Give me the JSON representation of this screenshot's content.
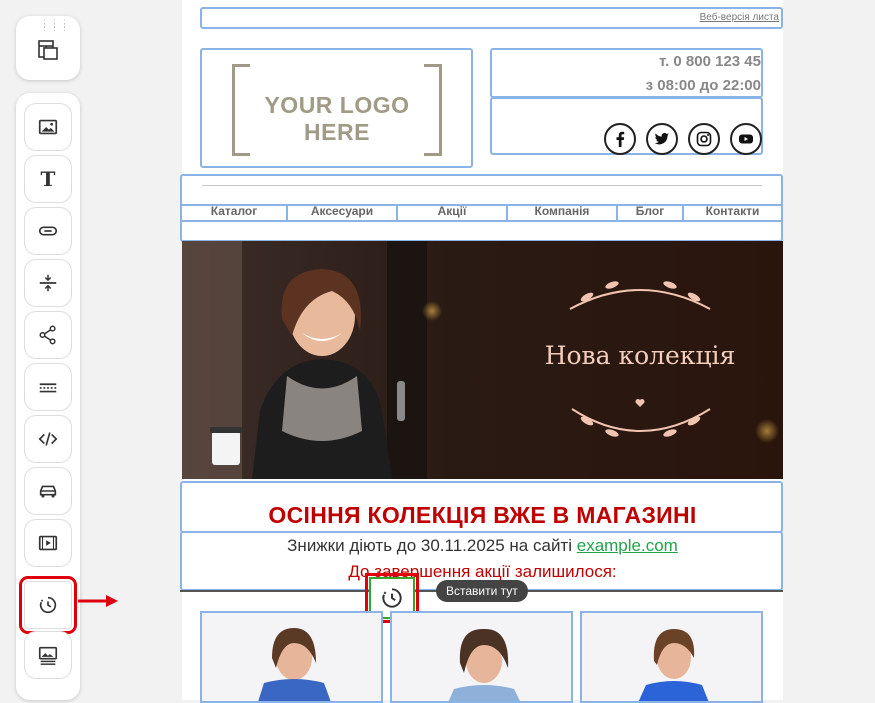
{
  "email": {
    "web_version_link": "Веб-версія листа",
    "logo_text": "YOUR LOGO HERE",
    "phone": "т. 0 800 123 45",
    "hours": "з 08:00 до 22:00",
    "social_icons": [
      "facebook-icon",
      "twitter-icon",
      "instagram-icon",
      "youtube-icon"
    ],
    "nav": [
      "Каталог",
      "Аксесуари",
      "Акції",
      "Компанія",
      "Блог",
      "Контакти"
    ],
    "banner_title": "Нова колекція",
    "headline": "ОСІННЯ КОЛЕКЦІЯ ВЖЕ В МАГАЗИНІ",
    "discount_text": "Знижки діють до 30.11.2025 на сайті",
    "site_link": "example.com",
    "countdown_label": "До завершення акції залишилося:"
  },
  "drop_tooltip": "Вставити тут",
  "toolbar": {
    "items": [
      "image-tool-icon",
      "text-tool-icon",
      "button-tool-icon",
      "spacer-tool-icon",
      "social-share-tool-icon",
      "divider-tool-icon",
      "html-code-tool-icon",
      "car-tool-icon",
      "video-tool-icon",
      "timer-tool-icon",
      "image-text-tool-icon"
    ]
  },
  "colors": {
    "accent_red": "#c00000",
    "highlight_red": "#e0000d",
    "link_green": "#22a34a",
    "selection_blue": "#8ab4e8"
  }
}
